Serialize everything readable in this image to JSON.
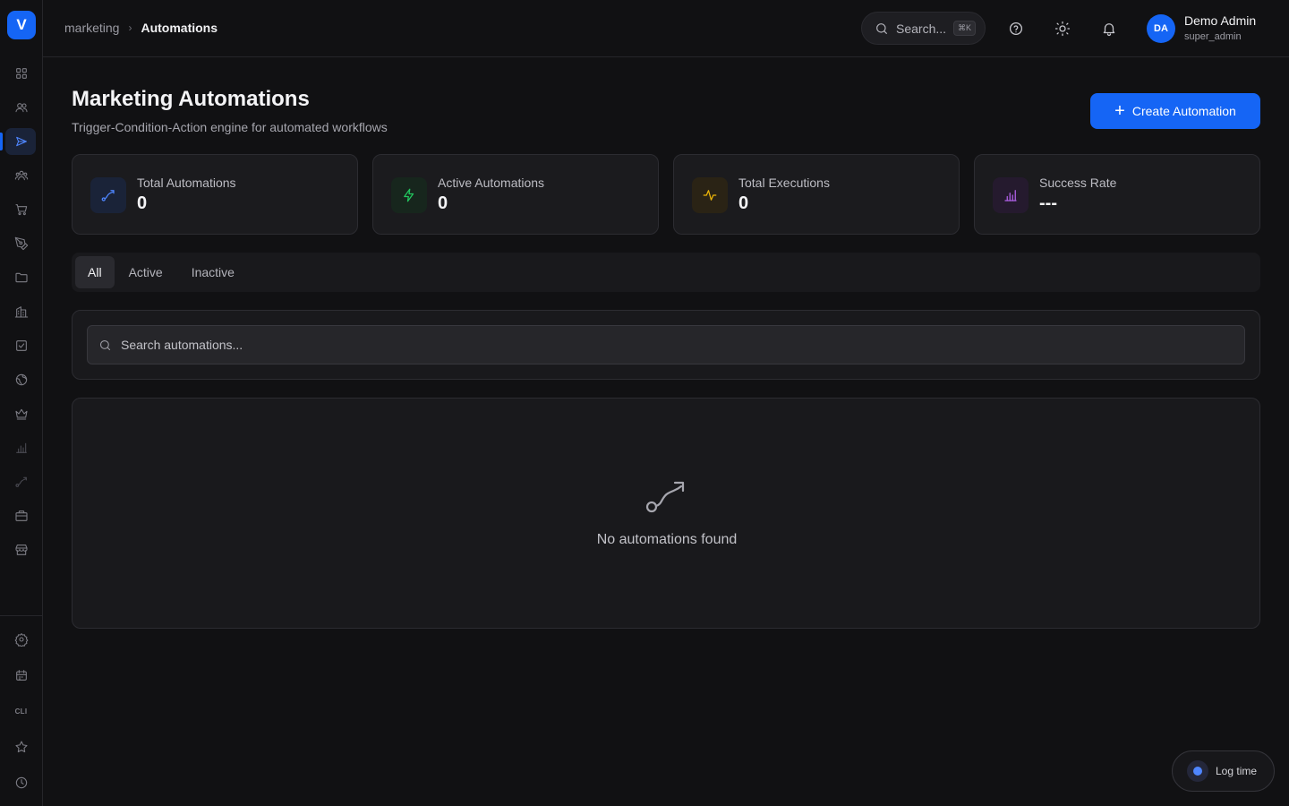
{
  "sidebar": {
    "logo_letter": "V",
    "items": [
      {
        "name": "dashboard",
        "icon": "grid-icon"
      },
      {
        "name": "contacts",
        "icon": "users-icon"
      },
      {
        "name": "marketing",
        "icon": "send-icon",
        "active": true
      },
      {
        "name": "teams",
        "icon": "team-icon"
      },
      {
        "name": "commerce",
        "icon": "cart-icon"
      },
      {
        "name": "content",
        "icon": "pen-tool-icon"
      },
      {
        "name": "files",
        "icon": "folder-icon"
      },
      {
        "name": "companies",
        "icon": "building-icon"
      },
      {
        "name": "tasks",
        "icon": "checkbox-icon"
      },
      {
        "name": "web",
        "icon": "globe-icon"
      },
      {
        "name": "loyalty",
        "icon": "crown-icon"
      },
      {
        "name": "analytics",
        "icon": "bar-chart-icon"
      },
      {
        "name": "workflows",
        "icon": "route-icon"
      },
      {
        "name": "jobs",
        "icon": "briefcase-icon"
      },
      {
        "name": "store",
        "icon": "store-icon"
      }
    ],
    "bottom_items": [
      {
        "name": "settings",
        "icon": "gear-icon"
      },
      {
        "name": "calendar",
        "icon": "calendar-icon"
      },
      {
        "name": "cli",
        "label": "CLI"
      },
      {
        "name": "favorites",
        "icon": "star-icon"
      },
      {
        "name": "history",
        "icon": "clock-icon"
      }
    ]
  },
  "topbar": {
    "breadcrumb_parent": "marketing",
    "breadcrumb_current": "Automations",
    "search_label": "Search...",
    "search_shortcut": "⌘K",
    "user_initials": "DA",
    "user_name": "Demo Admin",
    "user_role": "super_admin"
  },
  "header": {
    "title": "Marketing Automations",
    "subtitle": "Trigger-Condition-Action engine for automated workflows",
    "create_label": "Create Automation"
  },
  "stats": [
    {
      "label": "Total Automations",
      "value": "0",
      "color": "#4f86ff",
      "bg": "#1a2338",
      "icon": "route-icon"
    },
    {
      "label": "Active Automations",
      "value": "0",
      "color": "#22c55e",
      "bg": "#17261d",
      "icon": "zap-icon"
    },
    {
      "label": "Total Executions",
      "value": "0",
      "color": "#eab308",
      "bg": "#2a2315",
      "icon": "activity-icon"
    },
    {
      "label": "Success Rate",
      "value": "---",
      "color": "#b061e8",
      "bg": "#251a2e",
      "icon": "bar-chart-icon"
    }
  ],
  "tabs": [
    {
      "label": "All",
      "active": true
    },
    {
      "label": "Active"
    },
    {
      "label": "Inactive"
    }
  ],
  "search": {
    "placeholder": "Search automations..."
  },
  "empty_state": {
    "icon": "route-icon",
    "text": "No automations found"
  },
  "log_time": {
    "label": "Log time"
  }
}
